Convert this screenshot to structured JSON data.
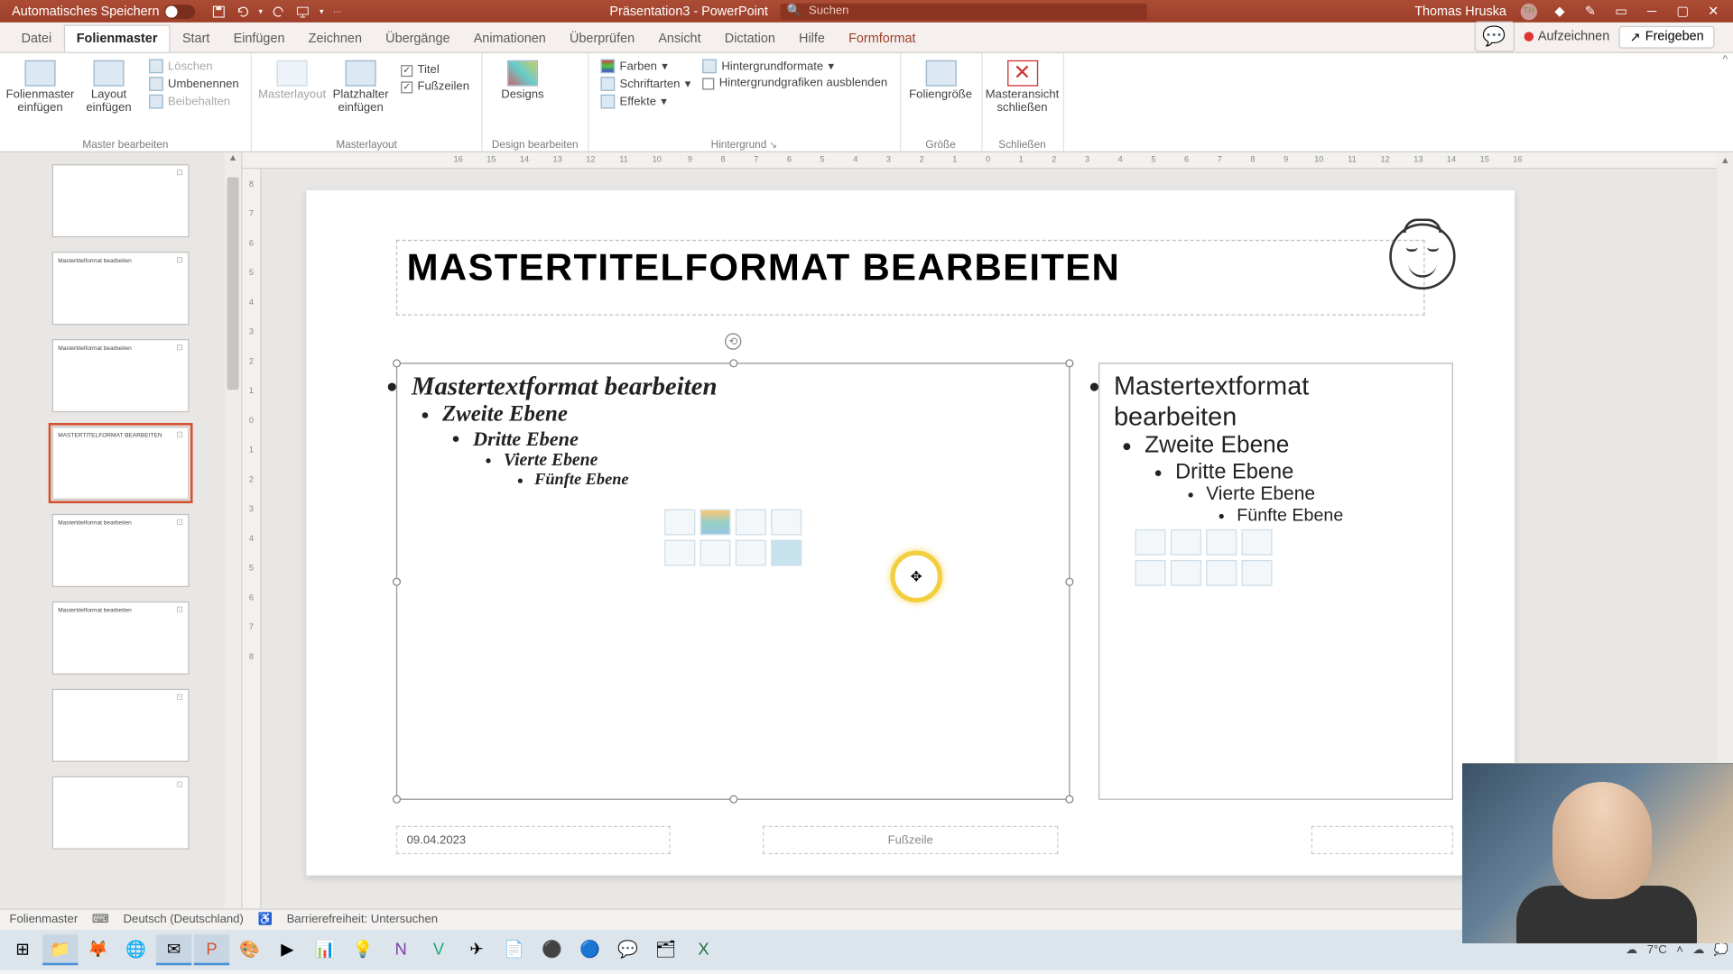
{
  "titlebar": {
    "autosave_label": "Automatisches Speichern",
    "doc_name": "Präsentation3 - PowerPoint",
    "search_placeholder": "Suchen",
    "user_name": "Thomas Hruska",
    "user_initials": "TH"
  },
  "tabs": [
    "Datei",
    "Folienmaster",
    "Start",
    "Einfügen",
    "Zeichnen",
    "Übergänge",
    "Animationen",
    "Überprüfen",
    "Ansicht",
    "Dictation",
    "Hilfe",
    "Formformat"
  ],
  "active_tab_index": 1,
  "context_tab_index": 11,
  "record_label": "Aufzeichnen",
  "share_label": "Freigeben",
  "ribbon": {
    "g1": {
      "insert_master": "Folienmaster einfügen",
      "insert_layout": "Layout einfügen",
      "delete": "Löschen",
      "rename": "Umbenennen",
      "preserve": "Beibehalten",
      "label": "Master bearbeiten"
    },
    "g2": {
      "master_layout": "Masterlayout",
      "placeholder": "Platzhalter einfügen",
      "title_chk": "Titel",
      "footer_chk": "Fußzeilen",
      "label": "Masterlayout"
    },
    "g3": {
      "designs": "Designs",
      "colors": "Farben",
      "fonts": "Schriftarten",
      "effects": "Effekte",
      "bg_styles": "Hintergrundformate",
      "hide_bg": "Hintergrundgrafiken ausblenden",
      "label_design": "Design bearbeiten",
      "label_bg": "Hintergrund"
    },
    "g4": {
      "size": "Foliengröße",
      "label": "Größe"
    },
    "g5": {
      "close": "Masteransicht schließen",
      "label": "Schließen"
    }
  },
  "ruler_h": [
    "16",
    "15",
    "14",
    "13",
    "12",
    "11",
    "10",
    "9",
    "8",
    "7",
    "6",
    "5",
    "4",
    "3",
    "2",
    "1",
    "0",
    "1",
    "2",
    "3",
    "4",
    "5",
    "6",
    "7",
    "8",
    "9",
    "10",
    "11",
    "12",
    "13",
    "14",
    "15",
    "16"
  ],
  "ruler_v": [
    "8",
    "7",
    "6",
    "5",
    "4",
    "3",
    "2",
    "1",
    "0",
    "1",
    "2",
    "3",
    "4",
    "5",
    "6",
    "7",
    "8"
  ],
  "thumbs": [
    {
      "title": ""
    },
    {
      "title": "Mastertitelformat bearbeiten"
    },
    {
      "title": "Mastertitelformat bearbeiten"
    },
    {
      "title": "MASTERTITELFORMAT BEARBEITEN",
      "selected": true
    },
    {
      "title": "Mastertitelformat bearbeiten"
    },
    {
      "title": "Mastertitelformat bearbeiten"
    },
    {
      "title": ""
    },
    {
      "title": ""
    }
  ],
  "slide": {
    "title": "MASTERTITELFORMAT BEARBEITEN",
    "left": {
      "l1": "Mastertextformat bearbeiten",
      "l2": "Zweite Ebene",
      "l3": "Dritte Ebene",
      "l4": "Vierte Ebene",
      "l5": "Fünfte Ebene"
    },
    "right": {
      "l1": "Mastertextformat bearbeiten",
      "l2": "Zweite Ebene",
      "l3": "Dritte Ebene",
      "l4": "Vierte Ebene",
      "l5": "Fünfte Ebene"
    },
    "date": "09.04.2023",
    "footer": "Fußzeile"
  },
  "statusbar": {
    "mode": "Folienmaster",
    "lang": "Deutsch (Deutschland)",
    "a11y": "Barrierefreiheit: Untersuchen"
  },
  "tray": {
    "weather": "7°C"
  }
}
